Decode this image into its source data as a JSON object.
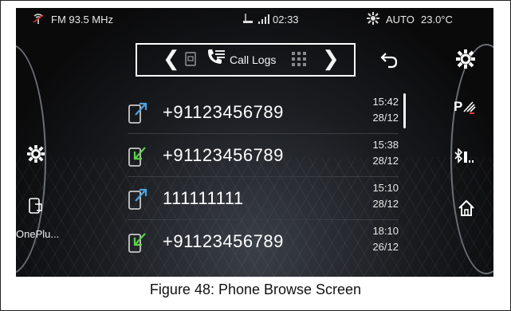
{
  "status_bar": {
    "radio": "FM 93.5 MHz",
    "time": "02:33",
    "climate_mode": "AUTO",
    "temperature": "23.0°C"
  },
  "nav": {
    "title": "Call Logs"
  },
  "left_panel": {
    "device_name": "OnePlu..."
  },
  "call_logs": [
    {
      "number": "+91123456789",
      "time": "15:42",
      "date": "28/12",
      "type": "outgoing"
    },
    {
      "number": "+91123456789",
      "time": "15:38",
      "date": "28/12",
      "type": "incoming"
    },
    {
      "number": "111111111",
      "time": "15:10",
      "date": "28/12",
      "type": "outgoing"
    },
    {
      "number": "+91123456789",
      "time": "18:10",
      "date": "26/12",
      "type": "incoming"
    }
  ],
  "caption": "Figure 48: Phone Browse Screen",
  "colors": {
    "outgoing_arrow": "#4aa3e0",
    "incoming_arrow": "#5bd24a",
    "screen_bg": "#0c0c0d"
  }
}
